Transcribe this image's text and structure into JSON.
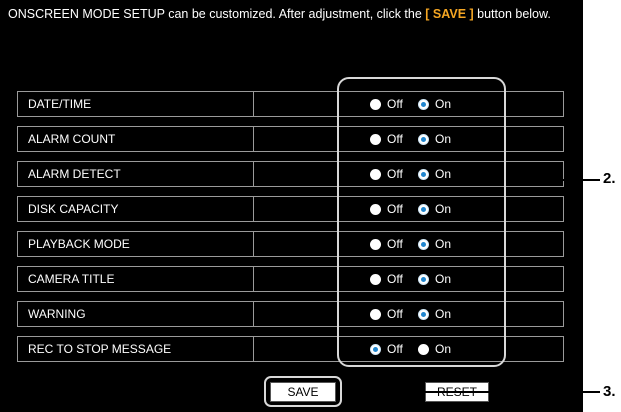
{
  "intro": {
    "text_before": "ONSCREEN MODE SETUP can be customized. After adjustment, click the ",
    "save_ref": "[ SAVE ]",
    "text_after": " button below."
  },
  "options": {
    "off_label": "Off",
    "on_label": "On"
  },
  "settings": [
    {
      "label": "DATE/TIME",
      "value": "On"
    },
    {
      "label": "ALARM COUNT",
      "value": "On"
    },
    {
      "label": "ALARM DETECT",
      "value": "On"
    },
    {
      "label": "DISK CAPACITY",
      "value": "On"
    },
    {
      "label": "PLAYBACK MODE",
      "value": "On"
    },
    {
      "label": "CAMERA TITLE",
      "value": "On"
    },
    {
      "label": "WARNING",
      "value": "On"
    },
    {
      "label": "REC TO STOP MESSAGE",
      "value": "Off"
    }
  ],
  "buttons": {
    "save": "SAVE",
    "reset": "RESET"
  },
  "callouts": {
    "radios": "2.",
    "save": "3."
  },
  "colors": {
    "accent": "#f5a623",
    "radio_selected": "#1f86cf",
    "panel_bg": "#000000"
  }
}
